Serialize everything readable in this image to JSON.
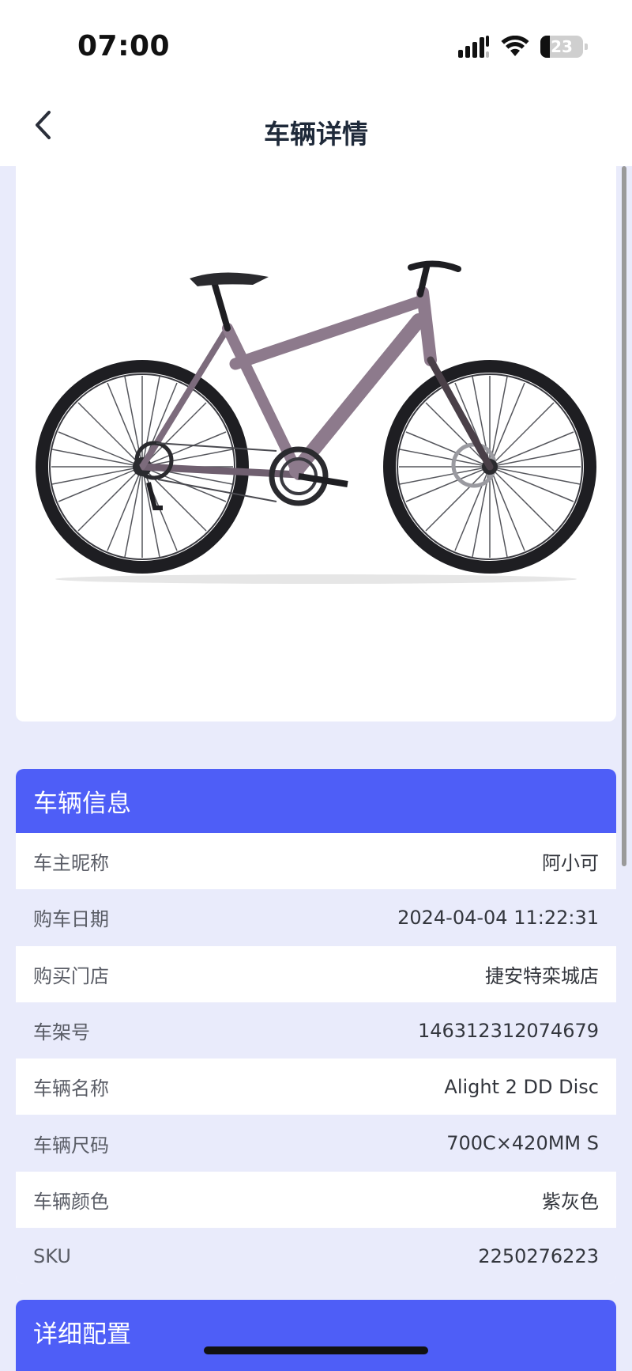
{
  "status_bar": {
    "time": "07:00",
    "battery_level": "23",
    "battery_fraction": 0.23,
    "icons": [
      "cellular-signal-icon",
      "wifi-icon",
      "battery-icon"
    ]
  },
  "nav": {
    "title": "车辆详情",
    "back_icon": "chevron-left-icon"
  },
  "product_image": {
    "subject": "bicycle",
    "frame_color": "#8d7a8c"
  },
  "vehicle_info": {
    "header": "车辆信息",
    "rows": [
      {
        "label": "车主昵称",
        "value": "阿小可"
      },
      {
        "label": "购车日期",
        "value": "2024-04-04 11:22:31"
      },
      {
        "label": "购买门店",
        "value": "捷安特栾城店"
      },
      {
        "label": "车架号",
        "value": "146312312074679"
      },
      {
        "label": "车辆名称",
        "value": "Alight 2 DD Disc"
      },
      {
        "label": "车辆尺码",
        "value": "700C×420MM S"
      },
      {
        "label": "车辆颜色",
        "value": "紫灰色"
      },
      {
        "label": "SKU",
        "value": "2250276223"
      }
    ]
  },
  "detail_config": {
    "header": "详细配置"
  },
  "colors": {
    "accent": "#4e5ef7",
    "page_background": "#e9ebfb",
    "title_text": "#1f2a3a"
  }
}
